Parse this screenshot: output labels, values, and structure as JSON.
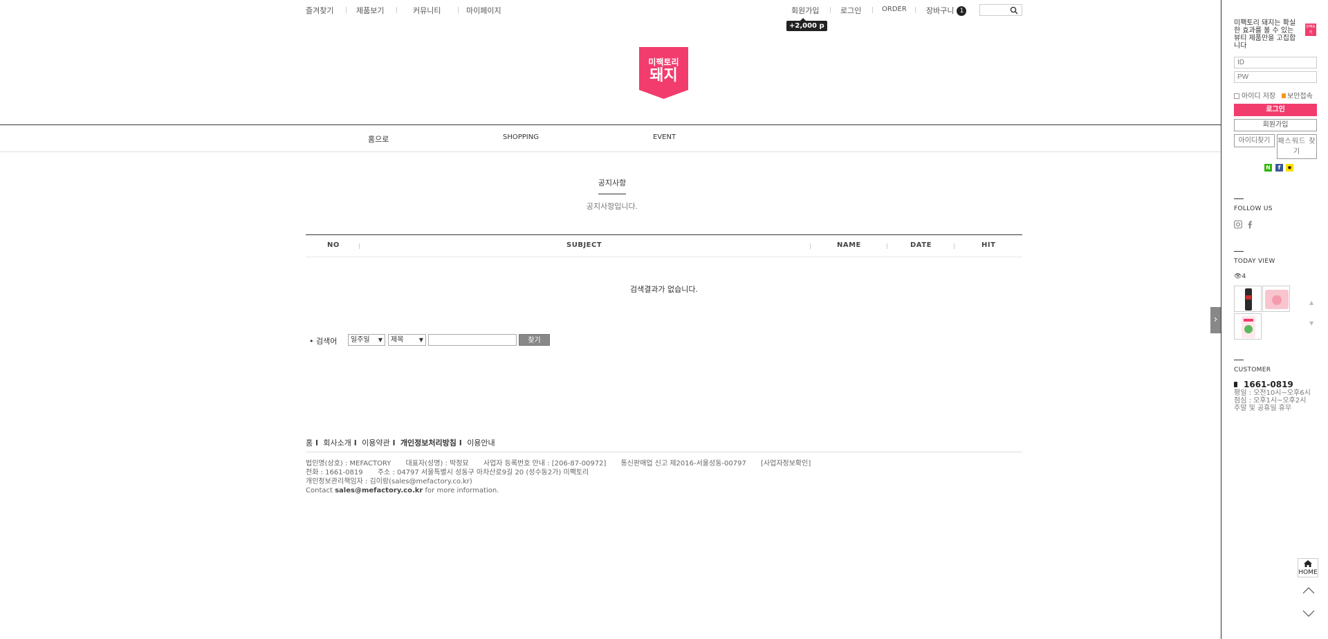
{
  "top_util": {
    "bookmark": "즐겨찾기",
    "products": "제품보기",
    "community": "커뮤니티",
    "mypage": "마이페이지",
    "join": "회원가입",
    "login": "로그인",
    "order": "ORDER",
    "cart": "장바구니",
    "cart_count": "1",
    "join_tooltip": "+2,000 p"
  },
  "logo": {
    "line1": "미팩토리",
    "line2": "돼지",
    "color": "#f23c6d"
  },
  "gnb": {
    "items": [
      "홈으로",
      "SHOPPING",
      "EVENT"
    ]
  },
  "board": {
    "title": "공지사항",
    "subtitle": "공지사항입니다.",
    "columns": [
      "NO",
      "SUBJECT",
      "NAME",
      "DATE",
      "HIT"
    ],
    "empty_message": "검색결과가 없습니다."
  },
  "search": {
    "label": "• 검색어",
    "period": "일주일",
    "field": "제목",
    "keyword_value": "",
    "submit": "찾기"
  },
  "footer": {
    "links": [
      "홈",
      "회사소개",
      "이용약관",
      "개인정보처리방침",
      "이용안내"
    ],
    "company": "법인명(상호) : MEFACTORY",
    "ceo": "대표자(성명) : 박정묘",
    "biz_no": "사업자 등록번호 안내 : [206-87-00972]",
    "ecommerce": "통신판매업 신고 제2016-서울성동-00797",
    "biz_check": "[사업자정보확인]",
    "tel": "전화 : 1661-0819",
    "address": "주소 : 04797 서울특별시 성동구 아차산로9길 20 (성수동2가) 미팩토리",
    "privacy_officer": "개인정보관리책임자 : 김이랑(sales@mefactory.co.kr)",
    "contact_prefix": "Contact ",
    "contact_email": "sales@mefactory.co.kr",
    "contact_suffix": " for more information."
  },
  "quick": {
    "description": "미팩토리 돼지는 확실한 효과를 볼 수 있는 뷰티 제품만을 고집합니다",
    "badge": "미팩토리",
    "id_placeholder": "ID",
    "pw_placeholder": "PW",
    "save_id": "아이디 저장",
    "secure_login": "보안접속",
    "login_button": "로그인",
    "join_button": "회원가입",
    "find_id": "아이디찾기",
    "find_pw": "패스워드 찾기",
    "sns": [
      "N",
      "f",
      "●"
    ],
    "sns_colors": [
      "#2db400",
      "#3b5998",
      "#f9e000"
    ],
    "follow_us": "FOLLOW US",
    "today_view": "TODAY VIEW",
    "today_count": "4",
    "customer": "CUSTOMER",
    "phone": "1661-0819",
    "hours_1": "평일 : 오전10시~오후6시",
    "hours_2": "점심 : 오후1시~오후2시",
    "hours_3": "주말 및 공휴일 휴무",
    "home": "HOME"
  }
}
